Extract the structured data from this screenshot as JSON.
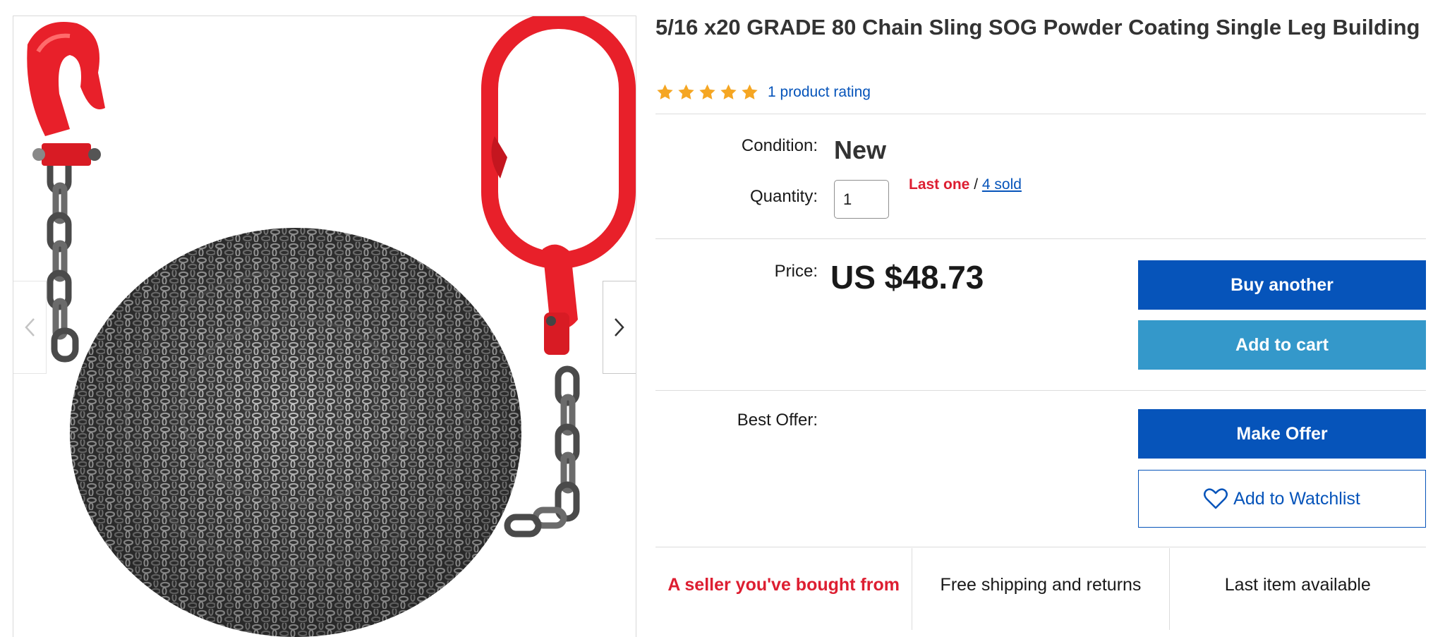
{
  "listing": {
    "title": "5/16 x20 GRADE 80 Chain Sling SOG Powder Coating Single Leg Building",
    "rating": {
      "stars": 5,
      "rating_link": "1 product rating"
    }
  },
  "gallery": {
    "prev_icon": "chevron-left-icon",
    "next_icon": "chevron-right-icon"
  },
  "condition": {
    "label": "Condition:",
    "value": "New"
  },
  "quantity": {
    "label": "Quantity:",
    "value": "1",
    "last_one": "Last one",
    "separator": " / ",
    "sold_link": "4 sold"
  },
  "price": {
    "label": "Price:",
    "value": "US $48.73"
  },
  "buttons": {
    "buy_another": "Buy another",
    "add_to_cart": "Add to cart",
    "make_offer": "Make Offer",
    "watchlist": "Add to Watchlist",
    "watchlist_icon": "heart-icon"
  },
  "best_offer": {
    "label": "Best Offer:"
  },
  "features": [
    {
      "text": "A seller you've bought from"
    },
    {
      "text": "Free shipping and returns"
    },
    {
      "text": "Last item available"
    }
  ],
  "colors": {
    "primary_blue": "#0654ba",
    "secondary_blue": "#3498ca",
    "alert_red": "#dd1e31",
    "star_orange": "#f5a623",
    "hook_red": "#e8202a"
  }
}
